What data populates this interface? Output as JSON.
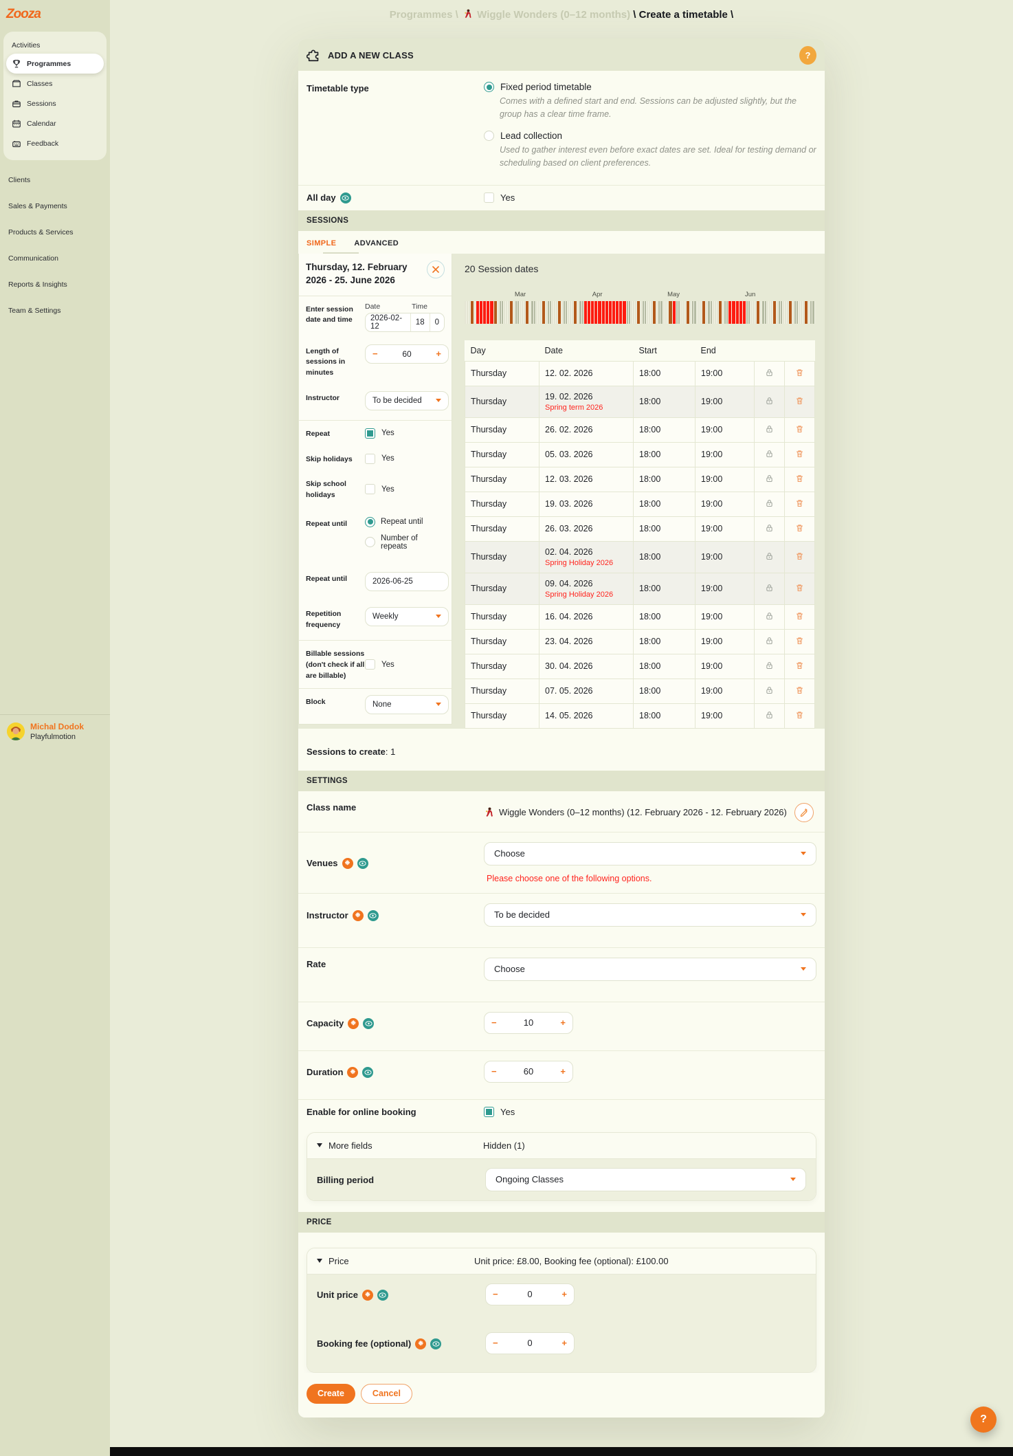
{
  "colors": {
    "accent_orange": "#f0741f",
    "teal": "#2f9a8f",
    "error_red": "#ff241e",
    "holiday_red": "#fd1b10",
    "session_brown": "#b2591b",
    "band_green": "#e0e4cc",
    "sidebar_green": "#dce0c4"
  },
  "sidebar": {
    "logo": "Zooza",
    "group_label": "Activities",
    "items": [
      {
        "label": "Programmes",
        "icon": "trophy-icon",
        "active": true
      },
      {
        "label": "Classes",
        "icon": "folder-icon",
        "active": false
      },
      {
        "label": "Sessions",
        "icon": "briefcase-icon",
        "active": false
      },
      {
        "label": "Calendar",
        "icon": "calendar-icon",
        "active": false
      },
      {
        "label": "Feedback",
        "icon": "feedback-icon",
        "active": false
      }
    ],
    "sections": [
      "Clients",
      "Sales & Payments",
      "Products & Services",
      "Communication",
      "Reports & Insights",
      "Team & Settings"
    ],
    "user": {
      "name": "Michal Dodok",
      "org": "Playfulmotion"
    }
  },
  "breadcrumb": {
    "parts": [
      {
        "text": "Programmes",
        "style": "muted"
      },
      {
        "text": " \\ ",
        "style": "muted"
      },
      {
        "icon": "dancer-icon"
      },
      {
        "text": " Wiggle Wonders (0–12 months)",
        "style": "muted"
      },
      {
        "text": " \\ ",
        "style": "current"
      },
      {
        "text": "Create a timetable",
        "style": "current"
      },
      {
        "text": " \\",
        "style": "current"
      }
    ]
  },
  "panel": {
    "header": {
      "title": "ADD A NEW CLASS",
      "help": "?"
    },
    "timetable": {
      "label": "Timetable type",
      "options": [
        {
          "label": "Fixed period timetable",
          "desc": "Comes with a defined start and end. Sessions can be adjusted slightly, but the group has a clear time frame.",
          "selected": true
        },
        {
          "label": "Lead collection",
          "desc": "Used to gather interest even before exact dates are set. Ideal for testing demand or scheduling based on client preferences.",
          "selected": false
        }
      ]
    },
    "all_day": {
      "label": "All day",
      "value": "Yes",
      "checked": false
    },
    "sessions_band": "SESSIONS",
    "tabs": [
      {
        "label": "SIMPLE",
        "active": true
      },
      {
        "label": "ADVANCED",
        "active": false
      }
    ],
    "session_card": {
      "title": "Thursday, 12. February 2026 - 25. June 2026",
      "enter_label": "Enter session date and time",
      "date_label": "Date",
      "time_label": "Time",
      "date_value": "2026-02-12",
      "hour_value": "18",
      "minute_value": "0",
      "length_label": "Length of sessions in minutes",
      "length_value": "60",
      "instructor_label": "Instructor",
      "instructor_value": "To be decided",
      "repeat_label": "Repeat",
      "repeat_value": "Yes",
      "skip_holidays_label": "Skip holidays",
      "skip_holidays_value": "Yes",
      "skip_school_label": "Skip school holidays",
      "skip_school_value": "Yes",
      "repeat_until_label": "Repeat until",
      "repeat_until_options": [
        {
          "label": "Repeat until",
          "selected": true
        },
        {
          "label": "Number of repeats",
          "selected": false
        }
      ],
      "repeat_until_date_label": "Repeat until",
      "repeat_until_date_value": "2026-06-25",
      "frequency_label": "Repetition frequency",
      "frequency_value": "Weekly",
      "billable_label": "Billable sessions (don't check if all are billable)",
      "billable_value": "Yes",
      "block_label": "Block",
      "block_value": "None"
    },
    "session_dates": {
      "title": "20 Session dates",
      "timeline": {
        "start": "2026-02-09",
        "end": "2026-06-28",
        "session_weekday": 4,
        "month_labels": [
          "Mar",
          "Apr",
          "May",
          "Jun"
        ],
        "holidays": [
          [
            "2026-02-14",
            "2026-02-18"
          ],
          [
            "2026-03-30",
            "2026-04-10"
          ],
          [
            "2026-05-01",
            "2026-05-01"
          ],
          [
            "2026-05-25",
            "2026-05-29"
          ]
        ]
      },
      "table": {
        "headers": [
          "Day",
          "Date",
          "Start",
          "End"
        ],
        "rows": [
          {
            "day": "Thursday",
            "date": "12. 02. 2026",
            "start": "18:00",
            "end": "19:00",
            "note": ""
          },
          {
            "day": "Thursday",
            "date": "19. 02. 2026",
            "start": "18:00",
            "end": "19:00",
            "note": "Spring term 2026"
          },
          {
            "day": "Thursday",
            "date": "26. 02. 2026",
            "start": "18:00",
            "end": "19:00",
            "note": ""
          },
          {
            "day": "Thursday",
            "date": "05. 03. 2026",
            "start": "18:00",
            "end": "19:00",
            "note": ""
          },
          {
            "day": "Thursday",
            "date": "12. 03. 2026",
            "start": "18:00",
            "end": "19:00",
            "note": ""
          },
          {
            "day": "Thursday",
            "date": "19. 03. 2026",
            "start": "18:00",
            "end": "19:00",
            "note": ""
          },
          {
            "day": "Thursday",
            "date": "26. 03. 2026",
            "start": "18:00",
            "end": "19:00",
            "note": ""
          },
          {
            "day": "Thursday",
            "date": "02. 04. 2026",
            "start": "18:00",
            "end": "19:00",
            "note": "Spring Holiday 2026"
          },
          {
            "day": "Thursday",
            "date": "09. 04. 2026",
            "start": "18:00",
            "end": "19:00",
            "note": "Spring Holiday 2026"
          },
          {
            "day": "Thursday",
            "date": "16. 04. 2026",
            "start": "18:00",
            "end": "19:00",
            "note": ""
          },
          {
            "day": "Thursday",
            "date": "23. 04. 2026",
            "start": "18:00",
            "end": "19:00",
            "note": ""
          },
          {
            "day": "Thursday",
            "date": "30. 04. 2026",
            "start": "18:00",
            "end": "19:00",
            "note": ""
          },
          {
            "day": "Thursday",
            "date": "07. 05. 2026",
            "start": "18:00",
            "end": "19:00",
            "note": ""
          },
          {
            "day": "Thursday",
            "date": "14. 05. 2026",
            "start": "18:00",
            "end": "19:00",
            "note": ""
          }
        ]
      }
    },
    "sessions_to_create": {
      "label": "Sessions to create",
      "value": ": 1"
    },
    "settings": {
      "band": "SETTINGS",
      "class_name_label": "Class name",
      "class_name_value": "Wiggle Wonders (0–12 months) (12. February 2026 - 12. February 2026)",
      "venues_label": "Venues",
      "venues_value": "Choose",
      "venues_error": "Please choose one of the following options.",
      "instructor_label": "Instructor",
      "instructor_value": "To be decided",
      "rate_label": "Rate",
      "rate_value": "Choose",
      "capacity_label": "Capacity",
      "capacity_value": "10",
      "duration_label": "Duration",
      "duration_value": "60",
      "online_label": "Enable for online booking",
      "online_value": "Yes",
      "more_fields_label": "More fields",
      "more_fields_hidden": "Hidden (1)",
      "billing_label": "Billing period",
      "billing_value": "Ongoing Classes"
    },
    "price": {
      "band": "PRICE",
      "header_label": "Price",
      "summary": "Unit price: £8.00, Booking fee (optional): £100.00",
      "unit_label": "Unit price",
      "unit_value": "0",
      "fee_label": "Booking fee (optional)",
      "fee_value": "0"
    },
    "actions": {
      "create": "Create",
      "cancel": "Cancel"
    },
    "floating_help": "?"
  }
}
